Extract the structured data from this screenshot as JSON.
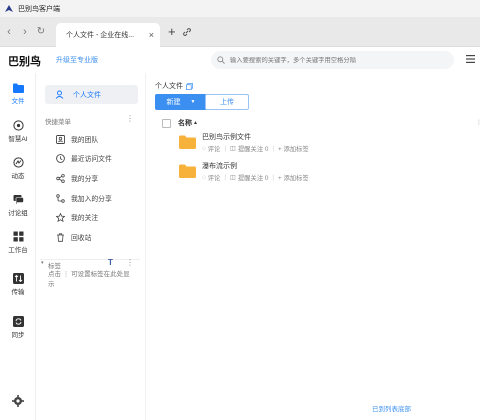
{
  "window": {
    "title": "巴别鸟客户端"
  },
  "tabbar": {
    "tab_label": "个人文件 - 企业在线...",
    "close": "×",
    "new_tab": "+"
  },
  "header": {
    "brand": "巴别鸟",
    "upgrade_label": "升级至专业版",
    "search_placeholder": "输入要搜索的关键字，多个关键字用空格分隔"
  },
  "rail": {
    "items": [
      {
        "label": "文件",
        "icon": "folder-icon",
        "active": true
      },
      {
        "label": "智慧AI",
        "icon": "ai-icon"
      },
      {
        "label": "动态",
        "icon": "activity-icon"
      },
      {
        "label": "讨论组",
        "icon": "chat-icon"
      },
      {
        "label": "工作台",
        "icon": "workspace-icon"
      },
      {
        "label": "传输",
        "icon": "transfer-icon"
      },
      {
        "label": "同步",
        "icon": "sync-icon"
      }
    ]
  },
  "sidebar": {
    "personal_label": "个人文件",
    "shortcut_title": "快捷菜单",
    "more": "⋮",
    "items": [
      {
        "label": "我的团队",
        "icon": "team-icon"
      },
      {
        "label": "最近访问文件",
        "icon": "clock-icon"
      },
      {
        "label": "我的分享",
        "icon": "share-icon"
      },
      {
        "label": "我加入的分享",
        "icon": "joined-share-icon"
      },
      {
        "label": "我的关注",
        "icon": "star-icon"
      },
      {
        "label": "回收站",
        "icon": "trash-icon"
      }
    ],
    "tags_title": "标签",
    "tags_empty_text": "点击 ⋮ 可设置标签在此处显示"
  },
  "main": {
    "breadcrumb": "个人文件",
    "new_button": "新建",
    "upload_button": "上传",
    "column_name": "名称",
    "rows": [
      {
        "name": "巴别鸟示例文件",
        "comment": "评论",
        "remind": "提醒关注 0",
        "add_tag": "+ 添加标签"
      },
      {
        "name": "瀑布流示例",
        "comment": "评论",
        "remind": "提醒关注 0",
        "add_tag": "+ 添加标签"
      }
    ],
    "footer": "已到列表底部"
  },
  "colors": {
    "accent": "#1677ff",
    "button": "#3b8ff0",
    "folder": "#f7b23b"
  }
}
